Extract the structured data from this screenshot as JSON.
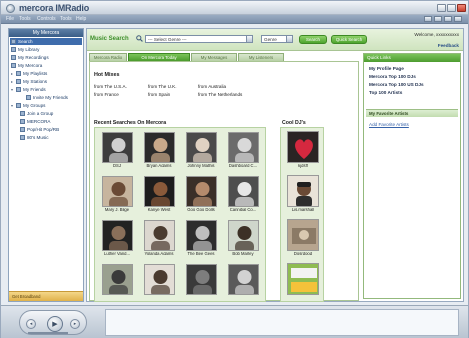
{
  "window": {
    "title": "mercora IMRadio"
  },
  "menu": [
    "File",
    "Tools",
    "Controls",
    "Tools",
    "Help"
  ],
  "sidebar": {
    "header": "My Mercora",
    "items": [
      {
        "label": "Search",
        "selected": true,
        "indent": 0
      },
      {
        "label": "My Library",
        "indent": 0
      },
      {
        "label": "My Recordings",
        "indent": 0
      },
      {
        "label": "My Mercora",
        "indent": 0
      },
      {
        "label": "My Playlists",
        "indent": 0,
        "expander": true
      },
      {
        "label": "My Stations",
        "indent": 0,
        "expander": true
      },
      {
        "label": "My Friends",
        "indent": 0,
        "expander": true
      },
      {
        "label": "Invite My Friends",
        "indent": 2
      },
      {
        "label": "My Groups",
        "indent": 0,
        "expander": true
      },
      {
        "label": "Join a Group",
        "indent": 1
      },
      {
        "label": "MERCORA",
        "indent": 1
      },
      {
        "label": "Pop/Hit Pop/RB",
        "indent": 1
      },
      {
        "label": "80's Music",
        "indent": 1
      }
    ],
    "footer": "Get Broadband"
  },
  "search": {
    "label": "Music Search",
    "genre_placeholder": "--- Select Genre ---",
    "genre_field": "Genre",
    "button1": "Search",
    "button2": "Quick Search"
  },
  "account": {
    "welcome": "Welcome, xxxxxxxxxx",
    "feedback": "Feedback"
  },
  "tabs": [
    "Mercora Radio",
    "On Mercora Today",
    "My Messages",
    "My Listeners"
  ],
  "hot_mixes": {
    "title": "Hot Mixes",
    "links": [
      "from The U.S.A.",
      "from The U.K.",
      "from Australia",
      "from France",
      "from Spain",
      "from The Netherlands"
    ]
  },
  "recent_searches": {
    "title": "Recent Searches On Mercora",
    "artists": [
      {
        "name": "DSJ"
      },
      {
        "name": "Bryan Adams"
      },
      {
        "name": "Johnny Mathis"
      },
      {
        "name": "Dashboard C..."
      },
      {
        "name": "Mary J. Blige"
      },
      {
        "name": "Kanye West"
      },
      {
        "name": "Goo Goo Dolls"
      },
      {
        "name": "Cannibal Co..."
      },
      {
        "name": "Luther Vand..."
      },
      {
        "name": "Yolanda Adams"
      },
      {
        "name": "The Bee Gees"
      },
      {
        "name": "Bob Marley"
      },
      {
        "name": ""
      },
      {
        "name": ""
      },
      {
        "name": ""
      },
      {
        "name": ""
      }
    ]
  },
  "cool_djs": {
    "title": "Cool DJ's",
    "djs": [
      {
        "name": "kjdsff"
      },
      {
        "name": "Lis.marshall"
      },
      {
        "name": "Dosrdood"
      },
      {
        "name": ""
      }
    ]
  },
  "right_panel": {
    "header": "Quick Links",
    "links": [
      "My Profile Page",
      "Mercora Top 100 DJs",
      "Mercora Top 100 US DJs",
      "Top 100 Artists"
    ],
    "favorites_header": "My Favorite Artists",
    "add_favorite": "Add Favorite Artists"
  },
  "colors": {
    "accent_green": "#4ea42f",
    "sidebar_select": "#3e6cac",
    "link_blue": "#3561a8"
  }
}
